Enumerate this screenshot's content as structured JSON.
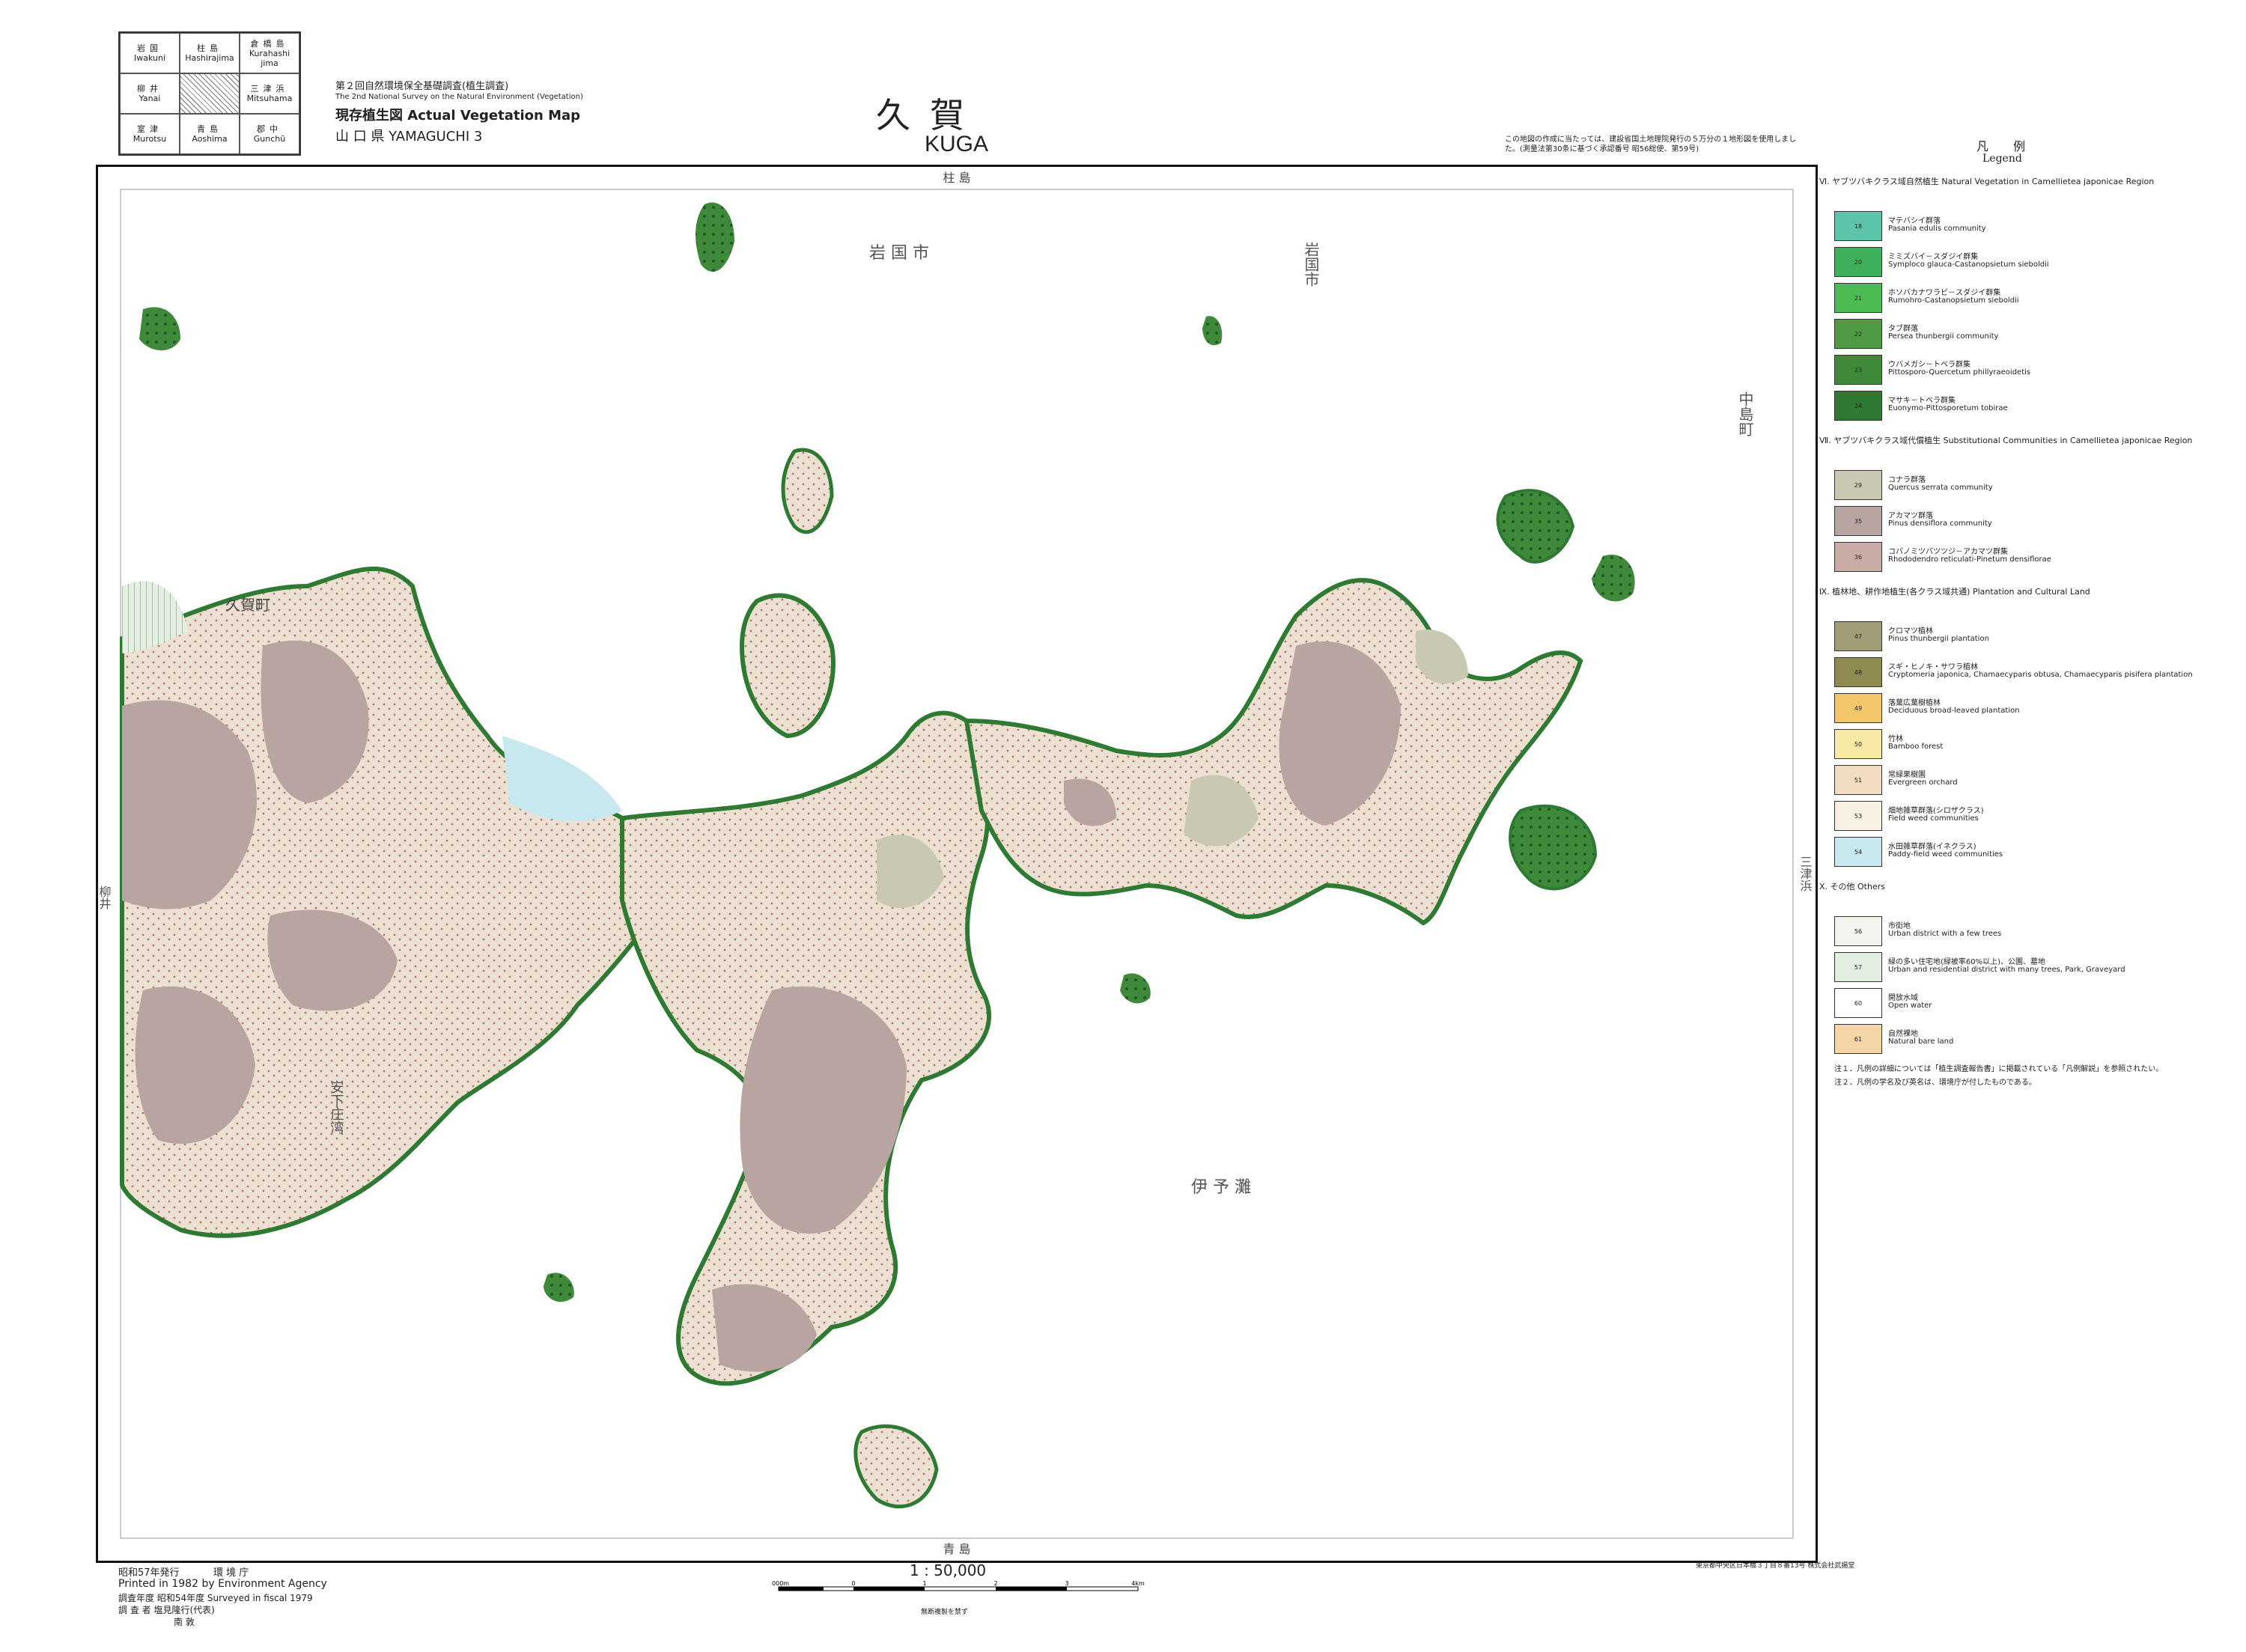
{
  "index_sheets": [
    {
      "jp": "岩国",
      "en": "Iwakuni"
    },
    {
      "jp": "柱島",
      "en": "Hashirajima"
    },
    {
      "jp": "倉橋島",
      "en": "Kurahashi jima"
    },
    {
      "jp": "柳井",
      "en": "Yanai"
    },
    {
      "jp": "",
      "en": ""
    },
    {
      "jp": "三津浜",
      "en": "Mitsuhama"
    },
    {
      "jp": "室津",
      "en": "Murotsu"
    },
    {
      "jp": "青島",
      "en": "Aoshima"
    },
    {
      "jp": "郡中",
      "en": "Gunchū"
    }
  ],
  "header": {
    "survey_line": "第２回自然環境保全基礎調査(植生調査)",
    "survey_en": "The 2nd National Survey on the Natural Environment (Vegetation)",
    "map_type": "現存植生図 Actual Vegetation Map",
    "prefecture": "山 口 県 YAMAGUCHI 3",
    "title_jp": "久賀",
    "title_en": "KUGA",
    "source_note": "この地図の作成に当たっては、建設省国土地理院発行の５万分の１地形図を使用しました。(測量法第30条に基づく承認番号 昭56総使、第59号)"
  },
  "map_labels": {
    "top_edge": "柱 島",
    "bottom_edge": "青 島",
    "iwakuni_city": "岩 国 市",
    "iwakuni_vertical": "岩国市",
    "kuga_town": "久賀町",
    "nakajima_town": "中島町",
    "iyo_nada": "伊 予 灘",
    "yanai": "柳井",
    "mitsuhama": "三津浜",
    "left_bay": "安下庄湾"
  },
  "legend": {
    "title_jp": "凡 例",
    "title_en": "Legend",
    "sections": [
      {
        "heading": "Ⅵ. ヤブツバキクラス域自然植生 Natural Vegetation in Camellietea japonicae Region",
        "items": [
          {
            "code": "18",
            "jp": "マテバシイ群落",
            "en": "Pasania edulis community",
            "color": "#5cc4a8"
          },
          {
            "code": "20",
            "jp": "ミミズバイ－スダジイ群集",
            "en": "Symploco glauca-Castanopsietum sieboldii",
            "color": "#3fb05a"
          },
          {
            "code": "21",
            "jp": "ホソバカナワラビ－スダジイ群集",
            "en": "Rumohro-Castanopsietum sieboldii",
            "color": "#4cbb52"
          },
          {
            "code": "22",
            "jp": "タブ群落",
            "en": "Persea thunbergii community",
            "color": "#4f9a45"
          },
          {
            "code": "23",
            "jp": "ウバメガシ－トベラ群集",
            "en": "Pittosporo-Quercetum phillyraeoidetis",
            "color": "#3f8a3a"
          },
          {
            "code": "24",
            "jp": "マサキ－トベラ群集",
            "en": "Euonymo-Pittosporetum tobirae",
            "color": "#2f7a33"
          }
        ]
      },
      {
        "heading": "Ⅶ. ヤブツバキクラス域代償植生 Substitutional Communities in Camellietea japonicae Region",
        "items": [
          {
            "code": "29",
            "jp": "コナラ群落",
            "en": "Quercus serrata community",
            "color": "#c9c9b3"
          },
          {
            "code": "35",
            "jp": "アカマツ群落",
            "en": "Pinus densiflora community",
            "color": "#b8a4a1"
          },
          {
            "code": "36",
            "jp": "コバノミツバツツジ－アカマツ群集",
            "en": "Rhododendro reticulati-Pinetum densiflorae",
            "color": "#c8aca5"
          }
        ]
      },
      {
        "heading": "Ⅸ. 植林地、耕作地植生(各クラス域共通) Plantation and Cultural Land",
        "items": [
          {
            "code": "47",
            "jp": "クロマツ植林",
            "en": "Pinus thunbergii plantation",
            "color": "#9e9d76"
          },
          {
            "code": "48",
            "jp": "スギ・ヒノキ・サワラ植林",
            "en": "Cryptomeria japonica, Chamaecyparis obtusa, Chamaecyparis pisifera plantation",
            "color": "#8e8a52"
          },
          {
            "code": "49",
            "jp": "落葉広葉樹植林",
            "en": "Deciduous broad-leaved plantation",
            "color": "#f2c76a"
          },
          {
            "code": "50",
            "jp": "竹林",
            "en": "Bamboo forest",
            "color": "#f7e8a6"
          },
          {
            "code": "51",
            "jp": "常緑果樹園",
            "en": "Evergreen orchard",
            "color": "#f2ddc2"
          },
          {
            "code": "53",
            "jp": "畑地雑草群落(シロザクラス)",
            "en": "Field weed communities",
            "color": "#f8f1e2"
          },
          {
            "code": "54",
            "jp": "水田雑草群落(イネクラス)",
            "en": "Paddy-field weed communities",
            "color": "#c8e8ef"
          }
        ]
      },
      {
        "heading": "Ⅹ. その他 Others",
        "items": [
          {
            "code": "56",
            "jp": "市街地",
            "en": "Urban district with a few trees",
            "color": "#f4f4ee"
          },
          {
            "code": "57",
            "jp": "緑の多い住宅地(緑被率60%以上)、公園、墓地",
            "en": "Urban and residential district with many trees, Park, Graveyard",
            "color": "#e2efe0"
          },
          {
            "code": "60",
            "jp": "開放水域",
            "en": "Open water",
            "color": "#ffffff"
          },
          {
            "code": "61",
            "jp": "自然裸地",
            "en": "Natural bare land",
            "color": "#f3d5a8"
          }
        ]
      }
    ],
    "notes": [
      "注１．凡例の詳細については「植生調査報告書」に掲載されている「凡例解説」を参照されたい。",
      "注２．凡例の学名及び英名は、環境庁が付したものである。"
    ]
  },
  "footer": {
    "publish_jp": "昭和57年発行",
    "publisher_jp": "環 境 庁",
    "printed_en": "Printed in 1982 by Environment Agency",
    "surveyed": "調査年度 昭和54年度 Surveyed in fiscal 1979",
    "surveyor": "調 査 者 塩見隆行(代表)",
    "surveyor2": "南 敦",
    "scale": "1 : 50,000",
    "scale_note": "無断複製を禁ず",
    "printer": "東京都中央区日本橋３丁目８番13号 株式会社武揚堂",
    "scale_ticks": [
      "1000m",
      "0",
      "1",
      "2",
      "3",
      "4km"
    ]
  }
}
